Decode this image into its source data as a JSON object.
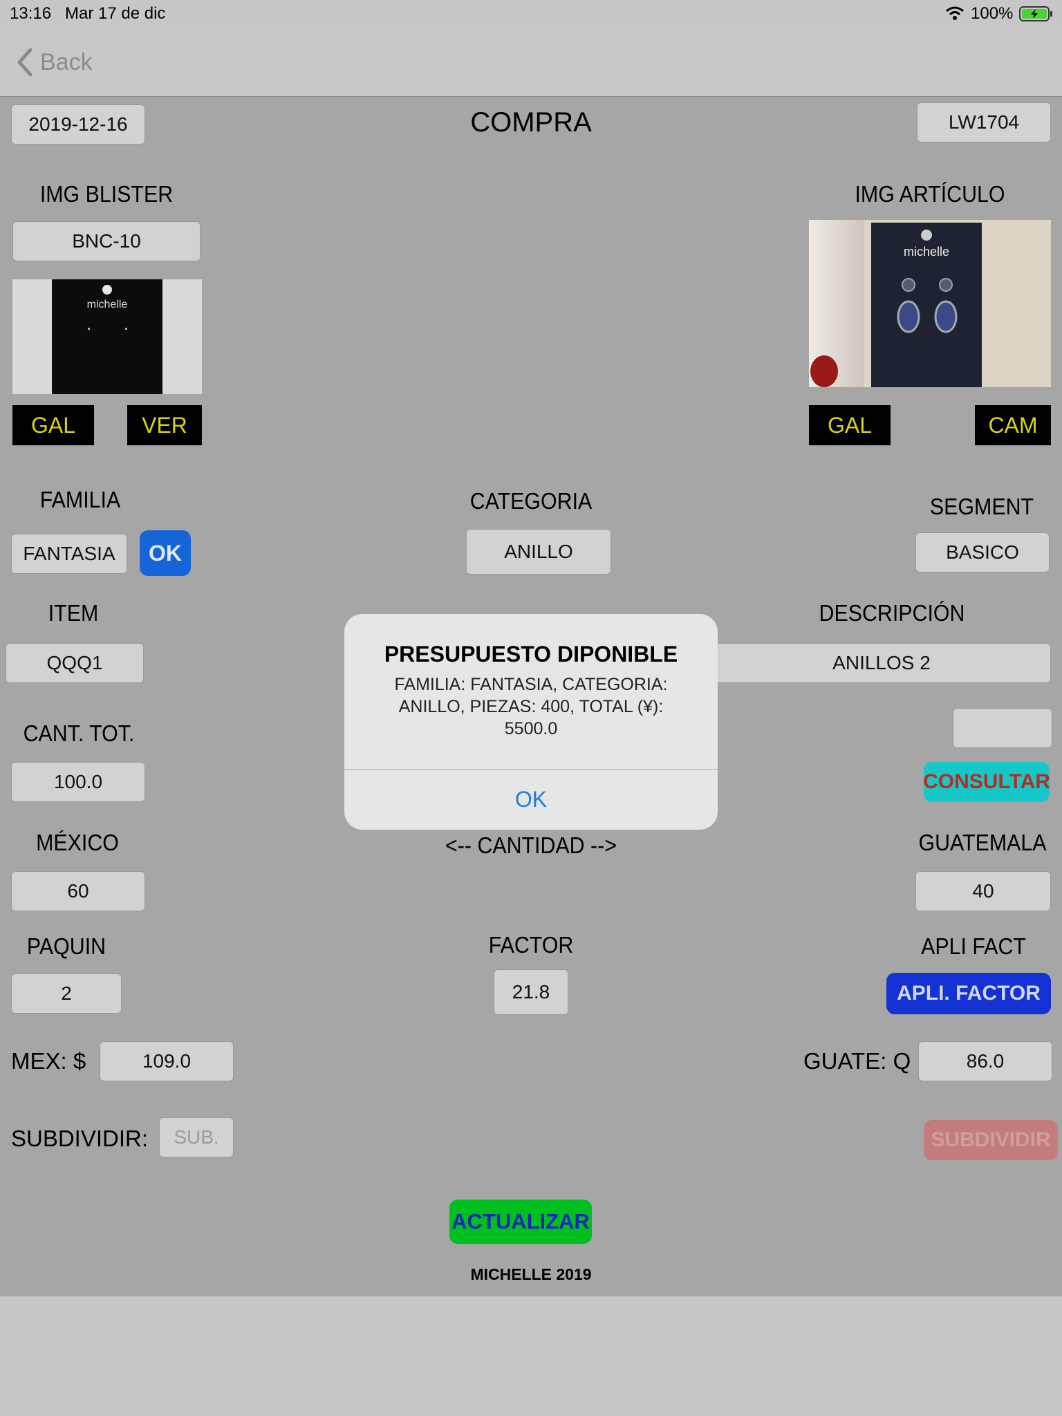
{
  "status_bar": {
    "time": "13:16",
    "date": "Mar 17 de dic",
    "battery": "100%"
  },
  "nav": {
    "back_label": "Back"
  },
  "header": {
    "date": "2019-12-16",
    "title": "COMPRA",
    "code": "LW1704"
  },
  "blister": {
    "label": "IMG BLISTER",
    "code": "BNC-10",
    "brand_text": "michelle",
    "gal_button": "GAL",
    "ver_button": "VER"
  },
  "articulo": {
    "label": "IMG ARTÍCULO",
    "brand_text": "michelle",
    "gal_button": "GAL",
    "cam_button": "CAM"
  },
  "familia": {
    "label": "FAMILIA",
    "value": "FANTASIA",
    "ok_button": "OK"
  },
  "categoria": {
    "label": "CATEGORIA",
    "value": "ANILLO"
  },
  "segment": {
    "label": "SEGMENT",
    "value": "BASICO"
  },
  "item": {
    "label": "ITEM",
    "value": "QQQ1"
  },
  "descripcion": {
    "label": "DESCRIPCIÓN",
    "value": "ANILLOS 2"
  },
  "cant_tot": {
    "label": "CANT. TOT.",
    "value": "100.0"
  },
  "consultar": {
    "field_value": "",
    "button": "CONSULTAR"
  },
  "mexico": {
    "label": "MÉXICO",
    "value": "60"
  },
  "cantidad_label": "<-- CANTIDAD -->",
  "guatemala": {
    "label": "GUATEMALA",
    "value": "40"
  },
  "paquin": {
    "label": "PAQUIN",
    "value": "2"
  },
  "factor": {
    "label": "FACTOR",
    "value": "21.8"
  },
  "apli_fact": {
    "label": "APLI FACT",
    "button": "APLI. FACTOR"
  },
  "mex_price": {
    "label": "MEX: $",
    "value": "109.0"
  },
  "guate_price": {
    "label": "GUATE: Q",
    "value": "86.0"
  },
  "subdividir": {
    "label": "SUBDIVIDIR:",
    "placeholder": "SUB.",
    "button": "SUBDIVIDIR"
  },
  "actualizar_button": "ACTUALIZAR",
  "footer": "MICHELLE 2019",
  "alert": {
    "title": "PRESUPUESTO DIPONIBLE",
    "message": "FAMILIA: FANTASIA, CATEGORIA: ANILLO, PIEZAS: 400, TOTAL (¥): 5500.0",
    "ok_button": "OK"
  },
  "colors": {
    "background": "#a6a6a6",
    "ok_blue": "#1565d8",
    "consultar_bg": "#15c8c8",
    "consultar_text": "#c0281e",
    "apli_bg": "#1432d4",
    "actualizar_bg": "#00c020",
    "actualizar_text": "#1428b4",
    "gal_text": "#d7d31a",
    "alert_link": "#1e7be8"
  }
}
